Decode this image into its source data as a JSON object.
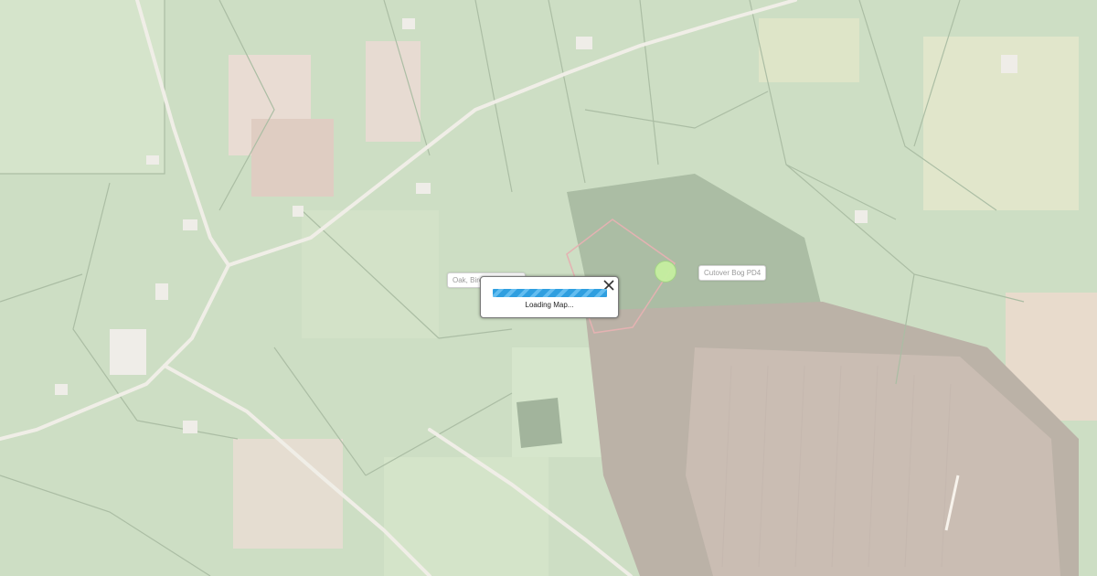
{
  "map": {
    "labels": [
      {
        "text": "Oak, Birc"
      },
      {
        "text": "Cutover Bog PD4"
      }
    ],
    "loading": {
      "text": "Loading Map...",
      "progress_percent": 100
    }
  },
  "colors": {
    "field_green": "#a9c79a",
    "road": "#e6e2d6",
    "bog_brown": "#a48d7c",
    "boundary_red": "#d17a7a",
    "progress_blue": "#2f9fe0",
    "marker_green": "#c5eea0"
  },
  "icons": {
    "close": "close-icon"
  }
}
